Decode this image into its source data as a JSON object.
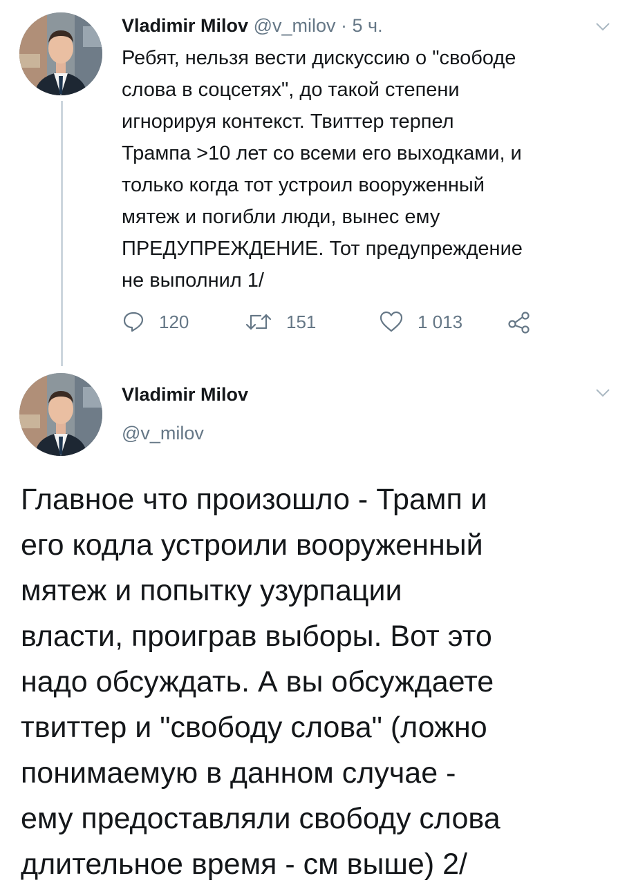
{
  "tweet1": {
    "author_name": "Vladimir Milov",
    "handle": "@v_milov",
    "separator": "·",
    "time": "5 ч.",
    "text_lines": [
      "Ребят, нельзя вести дискуссию о \"свободе",
      "слова в соцсетях\", до такой степени",
      "игнорируя контекст. Твиттер терпел",
      "Трампа >10 лет со всеми его выходками, и",
      "только когда тот устроил вооруженный",
      "мятеж и погибли люди, вынес ему",
      "ПРЕДУПРЕЖДЕНИЕ. Тот предупреждение",
      "не выполнил 1/"
    ],
    "actions": {
      "reply_count": "120",
      "retweet_count": "151",
      "like_count": "1 013"
    },
    "icons": [
      "reply-icon",
      "retweet-icon",
      "like-icon",
      "share-icon",
      "chevron-down-icon"
    ]
  },
  "tweet2": {
    "author_name": "Vladimir Milov",
    "handle": "@v_milov",
    "text_lines": [
      "Главное что произошло - Трамп и",
      "его кодла устроили вооруженный",
      "мятеж и попытку узурпации",
      "власти, проиграв выборы. Вот это",
      "надо обсуждать. А вы обсуждаете",
      "твиттер и \"свободу слова\" (ложно",
      "понимаемую в данном случае -",
      "ему предоставляли свободу слова",
      "длительное время - см выше) 2/"
    ]
  },
  "colors": {
    "text": "#14171a",
    "secondary": "#657786",
    "thread_line": "#ccd6dd",
    "background": "#ffffff"
  }
}
